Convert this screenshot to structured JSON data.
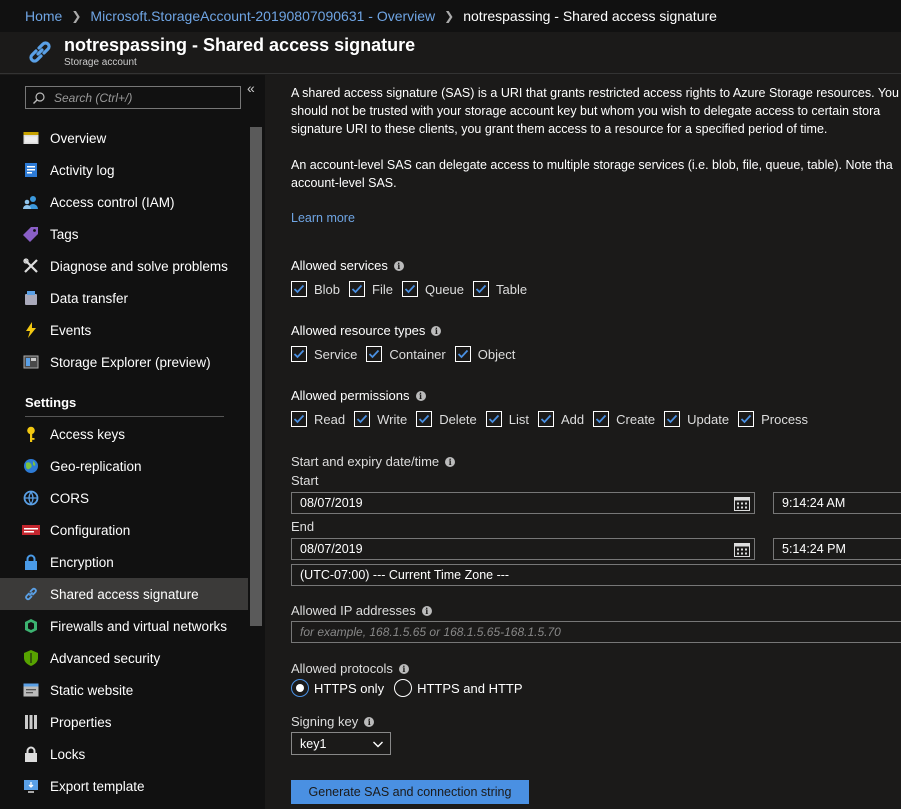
{
  "breadcrumb": {
    "home": "Home",
    "account": "Microsoft.StorageAccount-20190807090631 - Overview",
    "current": "notrespassing - Shared access signature"
  },
  "header": {
    "title": "notrespassing - Shared access signature",
    "subtitle": "Storage account"
  },
  "sidebar": {
    "search_placeholder": "Search (Ctrl+/)",
    "collapse": "«",
    "items": [
      {
        "label": "Overview",
        "icon": "overview-icon"
      },
      {
        "label": "Activity log",
        "icon": "activity-log-icon"
      },
      {
        "label": "Access control (IAM)",
        "icon": "iam-icon"
      },
      {
        "label": "Tags",
        "icon": "tag-icon"
      },
      {
        "label": "Diagnose and solve problems",
        "icon": "wrench-icon"
      },
      {
        "label": "Data transfer",
        "icon": "data-transfer-icon"
      },
      {
        "label": "Events",
        "icon": "lightning-icon"
      },
      {
        "label": "Storage Explorer (preview)",
        "icon": "storage-explorer-icon"
      }
    ],
    "settings_heading": "Settings",
    "settings_items": [
      {
        "label": "Access keys",
        "icon": "key-icon"
      },
      {
        "label": "Geo-replication",
        "icon": "globe-icon"
      },
      {
        "label": "CORS",
        "icon": "cors-icon"
      },
      {
        "label": "Configuration",
        "icon": "configuration-icon"
      },
      {
        "label": "Encryption",
        "icon": "lock-icon"
      },
      {
        "label": "Shared access signature",
        "icon": "link-icon"
      },
      {
        "label": "Firewalls and virtual networks",
        "icon": "firewall-icon"
      },
      {
        "label": "Advanced security",
        "icon": "shield-icon"
      },
      {
        "label": "Static website",
        "icon": "website-icon"
      },
      {
        "label": "Properties",
        "icon": "properties-icon"
      },
      {
        "label": "Locks",
        "icon": "lock-icon"
      },
      {
        "label": "Export template",
        "icon": "export-icon"
      }
    ]
  },
  "content": {
    "para1_line1": "A shared access signature (SAS) is a URI that grants restricted access rights to Azure Storage resources. You",
    "para1_line2": "should not be trusted with your storage account key but whom you wish to delegate access to certain stora",
    "para1_line3": "signature URI to these clients, you grant them access to a resource for a specified period of time.",
    "para2_line1": "An account-level SAS can delegate access to multiple storage services (i.e. blob, file, queue, table). Note tha",
    "para2_line2": "account-level SAS.",
    "learn_more": "Learn more",
    "services_label": "Allowed services",
    "services": [
      "Blob",
      "File",
      "Queue",
      "Table"
    ],
    "resource_types_label": "Allowed resource types",
    "resource_types": [
      "Service",
      "Container",
      "Object"
    ],
    "permissions_label": "Allowed permissions",
    "permissions": [
      "Read",
      "Write",
      "Delete",
      "List",
      "Add",
      "Create",
      "Update",
      "Process"
    ],
    "dates_label": "Start and expiry date/time",
    "start_label": "Start",
    "start_date": "08/07/2019",
    "start_time": "9:14:24 AM",
    "end_label": "End",
    "end_date": "08/07/2019",
    "end_time": "5:14:24 PM",
    "timezone": "(UTC-07:00) --- Current Time Zone ---",
    "ip_label": "Allowed IP addresses",
    "ip_placeholder": "for example, 168.1.5.65 or 168.1.5.65-168.1.5.70",
    "protocols_label": "Allowed protocols",
    "protocol_https": "HTTPS only",
    "protocol_both": "HTTPS and HTTP",
    "signing_key_label": "Signing key",
    "signing_key_value": "key1",
    "generate_button": "Generate SAS and connection string"
  },
  "colors": {
    "accent": "#4a90e2",
    "link": "#6fa5e4",
    "active_nav": "#3b3a39",
    "top_indicator": "#e68a00"
  }
}
